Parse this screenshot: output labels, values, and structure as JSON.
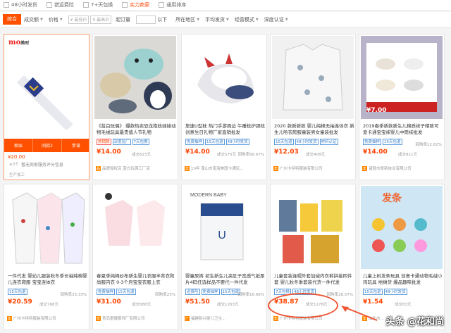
{
  "filters": [
    "48小时发货",
    "错运费险",
    "7+天包换",
    "实力商家",
    "通用排序"
  ],
  "toolbar": {
    "active": "综合",
    "sort1": "成交额",
    "sort2": "价格",
    "pmin": "¥ 最低价",
    "pmax": "¥ 最高价",
    "moq": "起订量",
    "below": "以下",
    "region": "所在地区",
    "avg": "平均发货",
    "mode": "经营模式",
    "cert": "深度认证"
  },
  "cards": [
    {
      "desc": "",
      "price": "¥20.00",
      "sub": "≥3个",
      "shop": "生产加工",
      "rate": "",
      "tags": [],
      "note": "暂无商家服务评分信息",
      "btns": [
        "相似",
        "同款2",
        "参谋"
      ]
    },
    {
      "desc": "《蓝白玩偶》 爆款热卖恐龙抱枕娃娃动物毛绒玩具最贵值人节礼物",
      "price": "¥14.00",
      "sold": "成交623元",
      "rate": "",
      "tags": [
        "热销款",
        "深度验厂",
        "7天包换"
      ],
      "shop": "品牌授权店 蓝白玩偶工厂店"
    },
    {
      "desc": "旅速U型枕 热门手游周边 午睡枕护颈枕创意生日礼物厂家直销批发",
      "price": "¥14.00",
      "sold": "成交575元",
      "rate": "回购率66.67%",
      "tags": [
        "免费抽样",
        "15天包退",
        "48小时发货"
      ],
      "shop": "19年 蓬山市南海美国卡通玩..."
    },
    {
      "desc": "2020 款新新款 婴儿纯棉无袖连体衣 新生儿哈衣爬服童装男女童装批发",
      "price": "¥12.03",
      "sold": "成交408元",
      "rate": "",
      "tags": [
        "15天包退",
        "48小时发货",
        "材料认证"
      ],
      "shop": "广州卡特特服装有限公司"
    },
    {
      "desc": "2019春季新款新生儿棉质袜子精致可爱卡通宝宝袜婴儿中筒袜批发",
      "price": "¥14.00",
      "sold": "成交811元",
      "rate": "回购率12.82%",
      "tags": [
        "免费抽样",
        "15天包退"
      ],
      "shop": "诸暨市景新袜业有限公司"
    },
    {
      "desc": "一件代发 婴幼儿服装秋冬季长袖纯棉婴儿连衣爬服 宝宝连体衣",
      "price": "¥20.59",
      "sold": "成交768元",
      "rate": "回购率33.33%",
      "tags": [
        "15天包退"
      ],
      "shop": "广州卡特特服装有限公司"
    },
    {
      "desc": "春夏季纯棉纱布新生婴儿衣服半背衣和尚服内衣 0-3个月宝宝衣服上衣",
      "price": "¥31.00",
      "sold": "成交688元",
      "rate": "回购率25%",
      "tags": [
        "免费抽样",
        "15天包退"
      ],
      "shop": "青岛童耀服饰厂有限公司"
    },
    {
      "desc": "婴童尿裤 初生新生儿夹肚子宽透气纸尿片4码任选样品不要代一件代发",
      "price": "¥51.50",
      "sold": "成交1263元",
      "rate": "回购率16.66%",
      "tags": [
        "运费险",
        "免费抽样",
        "15天包退"
      ],
      "shop": "福建新兴婴儿卫生..."
    },
    {
      "desc": "儿童套装连帽外套加绒内衣裤拼接四件套 婴儿秋冬季套装代货一件代发",
      "price": "¥38.87",
      "sold": "成交1276元",
      "rate": "回购率28.57%",
      "tags": [
        "7天包换",
        "48小时发货"
      ],
      "shop": "广州卡特特服装有限公司"
    },
    {
      "desc": "儿童上树发条玩具 创意卡通动物毛绒小鸡玩具 地摊货 爆品趣味批发",
      "price": "¥1.54",
      "sold": "成交63元",
      "rate": "",
      "tags": [
        "15天包退",
        "48小时发货"
      ],
      "shop": "汕头市..."
    }
  ],
  "watermark": "头条 @花和尚",
  "colors": {
    "accent": "#ff5000",
    "price": "#ff4400",
    "tag": "#3c7fc9"
  }
}
